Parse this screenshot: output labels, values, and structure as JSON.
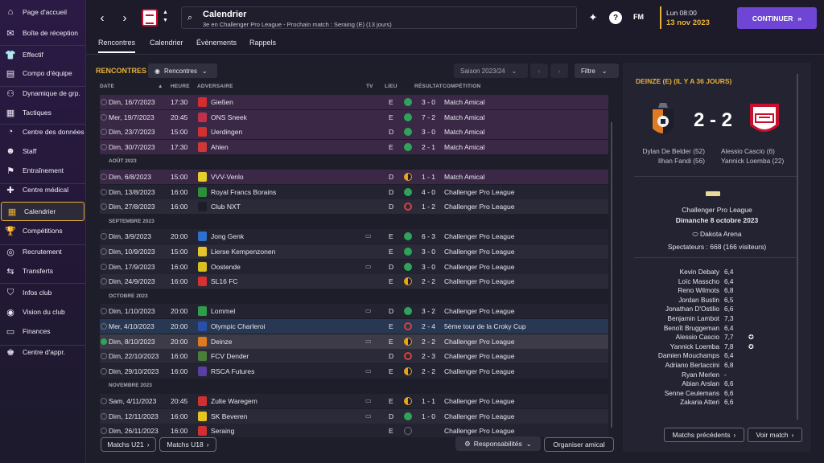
{
  "sidebar": {
    "items": [
      {
        "label": "Page d'accueil",
        "icon": "home-icon",
        "glyph": "⌂"
      },
      {
        "label": "Boîte de réception",
        "icon": "inbox-icon",
        "glyph": "✉"
      },
      {
        "label": "Effectif",
        "icon": "shirt-icon",
        "glyph": "👕"
      },
      {
        "label": "Compo d'équipe",
        "icon": "clipboard-icon",
        "glyph": "▤"
      },
      {
        "label": "Dynamique de grp.",
        "icon": "group-icon",
        "glyph": "⚇"
      },
      {
        "label": "Tactiques",
        "icon": "tactics-icon",
        "glyph": "▦"
      },
      {
        "label": "Centre des données",
        "icon": "data-icon",
        "glyph": "◔"
      },
      {
        "label": "Staff",
        "icon": "staff-icon",
        "glyph": "☻"
      },
      {
        "label": "Entraînement",
        "icon": "training-icon",
        "glyph": "⚑"
      },
      {
        "label": "Centre médical",
        "icon": "medical-icon",
        "glyph": "✚"
      },
      {
        "label": "Calendrier",
        "icon": "calendar-icon",
        "glyph": "▦"
      },
      {
        "label": "Compétitions",
        "icon": "trophy-icon",
        "glyph": "🏆"
      },
      {
        "label": "Recrutement",
        "icon": "scouting-icon",
        "glyph": "◎"
      },
      {
        "label": "Transferts",
        "icon": "transfers-icon",
        "glyph": "⇆"
      },
      {
        "label": "Infos club",
        "icon": "club-info-icon",
        "glyph": "⛉"
      },
      {
        "label": "Vision du club",
        "icon": "vision-icon",
        "glyph": "◉"
      },
      {
        "label": "Finances",
        "icon": "finances-icon",
        "glyph": "▭"
      },
      {
        "label": "Centre d'appr.",
        "icon": "learning-icon",
        "glyph": "♚"
      }
    ]
  },
  "header": {
    "title": "Calendrier",
    "subtitle": "3e en Challenger Pro League - Prochain match : Seraing (E) (13 jours)",
    "fm_label": "FM",
    "date_day": "Lun 08:00",
    "date": "13 nov 2023",
    "continue_label": "CONTINUER",
    "help_glyph": "?"
  },
  "tabs": [
    "Rencontres",
    "Calendrier",
    "Évènements",
    "Rappels"
  ],
  "panel": {
    "title": "RENCONTRES",
    "view_dropdown": "Rencontres",
    "season_dropdown": "Saison 2023/24",
    "filter_label": "Filtre",
    "headers": {
      "date": "DATE",
      "time": "HEURE",
      "opponent": "ADVERSAIRE",
      "tv": "TV",
      "venue": "LIEU",
      "result": "RÉSULTAT",
      "competition": "COMPÉTITION"
    }
  },
  "colors": {
    "win": "#2fa35a",
    "draw": "#e8a31a",
    "loss": "#d9403a",
    "accent": "#e8b23a",
    "continue": "#6e45d4"
  },
  "matches": [
    {
      "type": "match",
      "style": "purple",
      "date": "Dim, 16/7/2023",
      "time": "17:30",
      "opponent": "Gießen",
      "tv": "",
      "venue": "E",
      "res": "win",
      "score": "3 - 0",
      "comp": "Match Amical",
      "badge": "#d12f2f"
    },
    {
      "type": "match",
      "style": "purple",
      "date": "Mer, 19/7/2023",
      "time": "20:45",
      "opponent": "ONS Sneek",
      "tv": "",
      "venue": "E",
      "res": "win",
      "score": "7 - 2",
      "comp": "Match Amical",
      "badge": "#c0304a"
    },
    {
      "type": "match",
      "style": "purple",
      "date": "Dim, 23/7/2023",
      "time": "15:00",
      "opponent": "Uerdingen",
      "tv": "",
      "venue": "D",
      "res": "win",
      "score": "3 - 0",
      "comp": "Match Amical",
      "badge": "#d03030"
    },
    {
      "type": "match",
      "style": "purple",
      "date": "Dim, 30/7/2023",
      "time": "17:30",
      "opponent": "Ahlen",
      "tv": "",
      "venue": "E",
      "res": "win",
      "score": "2 - 1",
      "comp": "Match Amical",
      "badge": "#d03838"
    },
    {
      "type": "month",
      "label": "AOÛT 2023"
    },
    {
      "type": "match",
      "style": "purple",
      "date": "Dim, 6/8/2023",
      "time": "15:00",
      "opponent": "VVV-Venlo",
      "tv": "",
      "venue": "D",
      "res": "draw",
      "score": "1 - 1",
      "comp": "Match Amical",
      "badge": "#e5d02a"
    },
    {
      "type": "match",
      "style": "r-a",
      "date": "Dim, 13/8/2023",
      "time": "16:00",
      "opponent": "Royal Francs Borains",
      "tv": "",
      "venue": "D",
      "res": "win",
      "score": "4 - 0",
      "comp": "Challenger Pro League",
      "badge": "#2c8f3c"
    },
    {
      "type": "match",
      "style": "r-b",
      "date": "Dim, 27/8/2023",
      "time": "16:00",
      "opponent": "Club NXT",
      "tv": "",
      "venue": "D",
      "res": "loss",
      "score": "1 - 2",
      "comp": "Challenger Pro League",
      "badge": "#1d1e2a"
    },
    {
      "type": "month",
      "label": "SEPTEMBRE 2023"
    },
    {
      "type": "match",
      "style": "r-a",
      "date": "Dim, 3/9/2023",
      "time": "20:00",
      "opponent": "Jong Genk",
      "tv": "tv",
      "venue": "E",
      "res": "win",
      "score": "6 - 3",
      "comp": "Challenger Pro League",
      "badge": "#2f6fd0"
    },
    {
      "type": "match",
      "style": "r-b",
      "date": "Dim, 10/9/2023",
      "time": "15:00",
      "opponent": "Lierse Kempenzonen",
      "tv": "",
      "venue": "E",
      "res": "win",
      "score": "3 - 0",
      "comp": "Challenger Pro League",
      "badge": "#e5c52a"
    },
    {
      "type": "match",
      "style": "r-a",
      "date": "Dim, 17/9/2023",
      "time": "16:00",
      "opponent": "Oostende",
      "tv": "tv",
      "venue": "D",
      "res": "win",
      "score": "3 - 0",
      "comp": "Challenger Pro League",
      "badge": "#d8c020"
    },
    {
      "type": "match",
      "style": "r-b",
      "date": "Dim, 24/9/2023",
      "time": "16:00",
      "opponent": "SL16 FC",
      "tv": "",
      "venue": "E",
      "res": "draw",
      "score": "2 - 2",
      "comp": "Challenger Pro League",
      "badge": "#d83030"
    },
    {
      "type": "month",
      "label": "OCTOBRE 2023"
    },
    {
      "type": "match",
      "style": "r-a",
      "date": "Dim, 1/10/2023",
      "time": "20:00",
      "opponent": "Lommel",
      "tv": "tv",
      "venue": "D",
      "res": "win",
      "score": "3 - 2",
      "comp": "Challenger Pro League",
      "badge": "#2e9e4a"
    },
    {
      "type": "match",
      "style": "blue",
      "date": "Mer, 4/10/2023",
      "time": "20:00",
      "opponent": "Olympic Charleroi",
      "tv": "",
      "venue": "E",
      "res": "loss",
      "score": "2 - 4",
      "comp": "5ème tour de la Croky Cup",
      "badge": "#2a4fa8"
    },
    {
      "type": "match",
      "style": "sel",
      "date": "Dim, 8/10/2023",
      "time": "20:00",
      "opponent": "Deinze",
      "tv": "tv",
      "venue": "E",
      "res": "draw",
      "score": "2 - 2",
      "comp": "Challenger Pro League",
      "badge": "#e07a22",
      "selected": true
    },
    {
      "type": "match",
      "style": "r-b",
      "date": "Dim, 22/10/2023",
      "time": "16:00",
      "opponent": "FCV Dender",
      "tv": "",
      "venue": "D",
      "res": "loss",
      "score": "2 - 3",
      "comp": "Challenger Pro League",
      "badge": "#4a7f3a"
    },
    {
      "type": "match",
      "style": "r-a",
      "date": "Dim, 29/10/2023",
      "time": "16:00",
      "opponent": "RSCA Futures",
      "tv": "tv",
      "venue": "E",
      "res": "draw",
      "score": "2 - 2",
      "comp": "Challenger Pro League",
      "badge": "#5a3ea0"
    },
    {
      "type": "month",
      "label": "NOVEMBRE 2023"
    },
    {
      "type": "match",
      "style": "r-a",
      "date": "Sam, 4/11/2023",
      "time": "20:45",
      "opponent": "Zulte Waregem",
      "tv": "tv",
      "venue": "E",
      "res": "draw",
      "score": "1 - 1",
      "comp": "Challenger Pro League",
      "badge": "#d13030"
    },
    {
      "type": "match",
      "style": "r-b",
      "date": "Dim, 12/11/2023",
      "time": "16:00",
      "opponent": "SK Beveren",
      "tv": "tv",
      "venue": "D",
      "res": "win",
      "score": "1 - 0",
      "comp": "Challenger Pro League",
      "badge": "#e5c520"
    },
    {
      "type": "match",
      "style": "r-a",
      "date": "Dim, 26/11/2023",
      "time": "16:00",
      "opponent": "Seraing",
      "tv": "",
      "venue": "E",
      "res": "none",
      "score": "",
      "comp": "Challenger Pro League",
      "badge": "#d03030"
    }
  ],
  "bottom": {
    "u21": "Matchs U21",
    "u18": "Matchs U18",
    "responsibilities": "Responsabilités",
    "friendly": "Organiser amical"
  },
  "detail": {
    "title": "DEINZE (E) (IL Y A 36 JOURS)",
    "score": "2 - 2",
    "left_scorers": [
      "Dylan De Belder (52)",
      "Ilhan Fandi (56)"
    ],
    "right_scorers": [
      "Alessio Cascio (6)",
      "Yannick Loemba (22)"
    ],
    "competition": "Challenger Pro League",
    "date": "Dimanche 8 octobre 2023",
    "stadium": "Dakota Arena",
    "attendance": "Spectateurs : 668 (166 visiteurs)",
    "ratings": [
      {
        "name": "Kevin Debaty",
        "val": "6,4"
      },
      {
        "name": "Loïc Masscho",
        "val": "6,4"
      },
      {
        "name": "Reno Wilmots",
        "val": "6,8"
      },
      {
        "name": "Jordan Bustin",
        "val": "6,5"
      },
      {
        "name": "Jonathan D'Ostilio",
        "val": "6,6"
      },
      {
        "name": "Benjamin Lambot",
        "val": "7,3"
      },
      {
        "name": "Benoît Bruggeman",
        "val": "6,4"
      },
      {
        "name": "Alessio Cascio",
        "val": "7,7",
        "goal": true
      },
      {
        "name": "Yannick Loemba",
        "val": "7,8",
        "goal": true
      },
      {
        "name": "Damien Mouchamps",
        "val": "6,4"
      },
      {
        "name": "Adriano Bertaccini",
        "val": "6,8"
      },
      {
        "name": "Ryan Merlen",
        "val": "-"
      },
      {
        "name": "Abian Arslan",
        "val": "6,6"
      },
      {
        "name": "Senne Ceulemans",
        "val": "6,6"
      },
      {
        "name": "Zakaria Atteri",
        "val": "6,6"
      }
    ],
    "prev_label": "Matchs précédents",
    "view_label": "Voir match"
  }
}
